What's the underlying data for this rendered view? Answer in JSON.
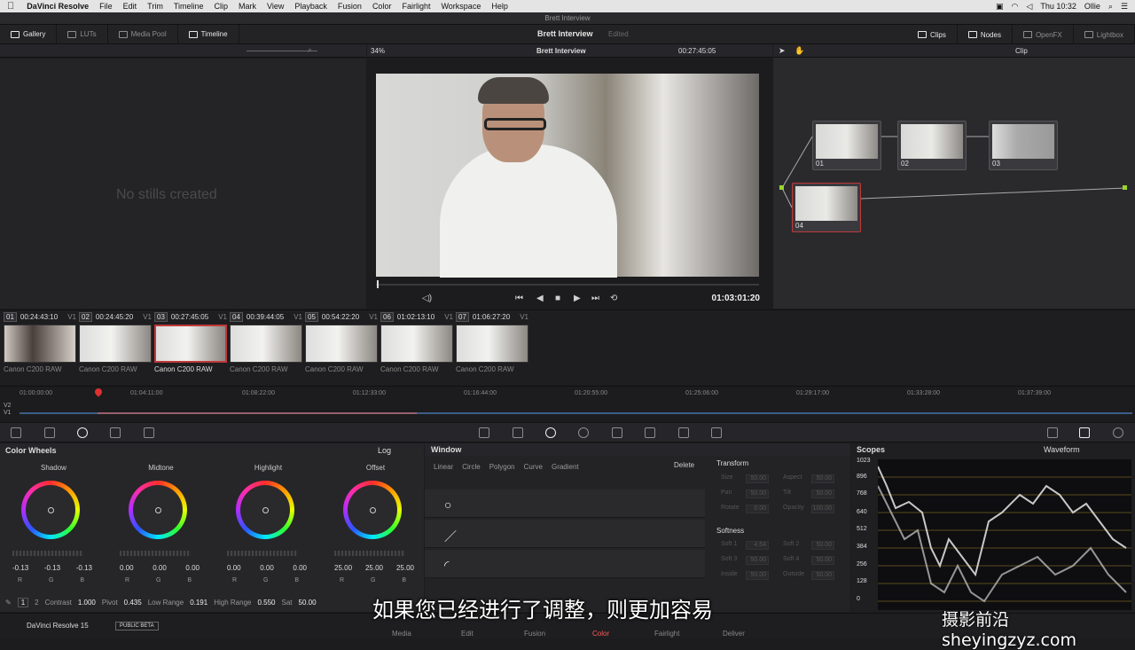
{
  "menubar": {
    "app": "DaVinci Resolve",
    "items": [
      "File",
      "Edit",
      "Trim",
      "Timeline",
      "Clip",
      "Mark",
      "View",
      "Playback",
      "Fusion",
      "Color",
      "Fairlight",
      "Workspace",
      "Help"
    ],
    "clock": "Thu 10:32",
    "user": "Ollie"
  },
  "window_title": "Brett Interview",
  "top_tabs": {
    "left": [
      "Gallery",
      "LUTs",
      "Media Pool",
      "Timeline"
    ],
    "project_title": "Brett Interview",
    "project_status": "Edited",
    "right": [
      "Clips",
      "Nodes",
      "OpenFX",
      "Lightbox"
    ]
  },
  "gallery": {
    "empty_text": "No stills created"
  },
  "viewer": {
    "zoom": "34%",
    "clip_name": "Brett Interview",
    "source_timecode": "00:27:45:05",
    "record_timecode": "01:03:01:20"
  },
  "node_panel": {
    "mode": "Clip",
    "nodes": [
      {
        "label": "01"
      },
      {
        "label": "02"
      },
      {
        "label": "03"
      },
      {
        "label": "04"
      }
    ]
  },
  "clips": [
    {
      "num": "01",
      "tc": "00:24:43:10",
      "track": "V1",
      "name": "Canon C200 RAW"
    },
    {
      "num": "02",
      "tc": "00:24:45:20",
      "track": "V1",
      "name": "Canon C200 RAW"
    },
    {
      "num": "03",
      "tc": "00:27:45:05",
      "track": "V1",
      "name": "Canon C200 RAW"
    },
    {
      "num": "04",
      "tc": "00:39:44:05",
      "track": "V1",
      "name": "Canon C200 RAW"
    },
    {
      "num": "05",
      "tc": "00:54:22:20",
      "track": "V1",
      "name": "Canon C200 RAW"
    },
    {
      "num": "06",
      "tc": "01:02:13:10",
      "track": "V1",
      "name": "Canon C200 RAW"
    },
    {
      "num": "07",
      "tc": "01:06:27:20",
      "track": "V1",
      "name": "Canon C200 RAW"
    }
  ],
  "timeline": {
    "ticks": [
      "01:00:00:00",
      "01:04:11:00",
      "01:08:22:00",
      "01:12:33:00",
      "01:16:44:00",
      "01:20:55:00",
      "01:25:06:00",
      "01:29:17:00",
      "01:33:28:00",
      "01:37:39:00"
    ],
    "tracks": [
      "V2",
      "V1"
    ]
  },
  "color_wheels": {
    "title": "Color Wheels",
    "mode": "Log",
    "wheels": [
      {
        "name": "Shadow",
        "values": [
          "-0.13",
          "-0.13",
          "-0.13"
        ]
      },
      {
        "name": "Midtone",
        "values": [
          "0.00",
          "0.00",
          "0.00"
        ]
      },
      {
        "name": "Highlight",
        "values": [
          "0.00",
          "0.00",
          "0.00"
        ]
      },
      {
        "name": "Offset",
        "values": [
          "25.00",
          "25.00",
          "25.00"
        ]
      }
    ],
    "rgb": [
      "R",
      "G",
      "B"
    ],
    "bottom": {
      "page1": "1",
      "page2": "2",
      "contrast_label": "Contrast",
      "contrast": "1.000",
      "pivot_label": "Pivot",
      "pivot": "0.435",
      "low_range_label": "Low Range",
      "low_range": "0.191",
      "high_range_label": "High Range",
      "high_range": "0.550",
      "sat_label": "Sat",
      "sat": "50.00"
    }
  },
  "window_panel": {
    "title": "Window",
    "shapes": [
      "Linear",
      "Circle",
      "Polygon",
      "Curve",
      "Gradient"
    ],
    "delete_label": "Delete",
    "rows": [
      "○",
      "／",
      "◜"
    ],
    "transform_title": "Transform",
    "transform": [
      [
        "Size",
        "50.00",
        "Aspect",
        "50.00"
      ],
      [
        "Pan",
        "50.00",
        "Tilt",
        "50.00"
      ],
      [
        "Rotate",
        "0.00",
        "Opacity",
        "100.00"
      ]
    ],
    "softness_title": "Softness",
    "softness": [
      [
        "Soft 1",
        "4.54",
        "Soft 2",
        "50.00"
      ],
      [
        "Soft 3",
        "50.00",
        "Soft 4",
        "50.00"
      ],
      [
        "Inside",
        "50.00",
        "Outside",
        "50.00"
      ]
    ]
  },
  "scopes": {
    "title": "Scopes",
    "mode": "Waveform",
    "labels": [
      "1023",
      "896",
      "768",
      "640",
      "512",
      "384",
      "256",
      "128",
      "0"
    ]
  },
  "pages": {
    "brand": "DaVinci Resolve 15",
    "beta": "PUBLIC BETA",
    "items": [
      "Media",
      "Edit",
      "Fusion",
      "Color",
      "Fairlight",
      "Deliver"
    ],
    "active": "Color"
  },
  "overlay": {
    "subtitle": "如果您已经进行了调整，则更加容易",
    "watermark": "摄影前沿sheyingzyz.com"
  }
}
